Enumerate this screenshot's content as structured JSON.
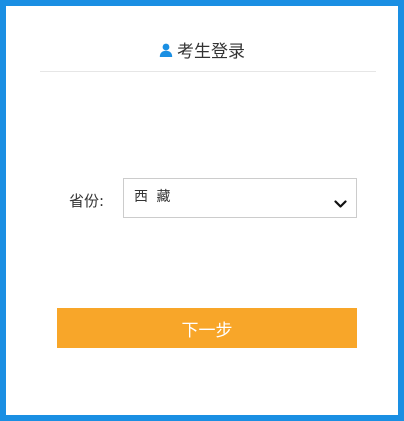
{
  "header": {
    "title": "考生登录",
    "icon": "user-icon"
  },
  "form": {
    "province_label": "省份:",
    "province_value": "西 藏",
    "dropdown_icon": "chevron-down-icon"
  },
  "actions": {
    "next_label": "下一步"
  },
  "colors": {
    "frame_border": "#1a8fe3",
    "icon_blue": "#1a8fe3",
    "button": "#f8a629",
    "divider": "#e6e6e6"
  }
}
